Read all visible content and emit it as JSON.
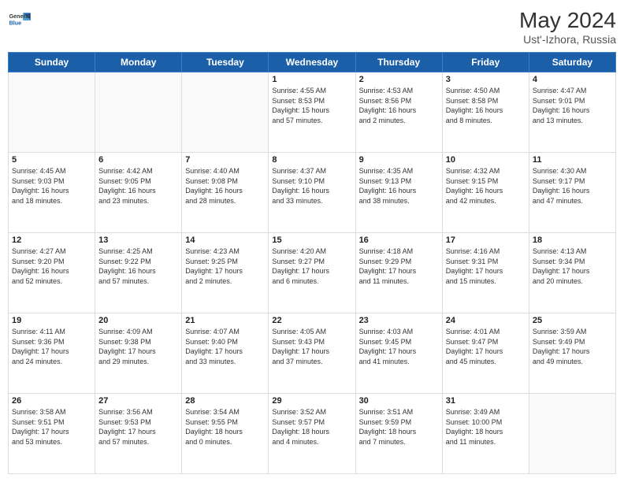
{
  "header": {
    "logo_general": "General",
    "logo_blue": "Blue",
    "month_year": "May 2024",
    "location": "Ust'-Izhora, Russia"
  },
  "weekdays": [
    "Sunday",
    "Monday",
    "Tuesday",
    "Wednesday",
    "Thursday",
    "Friday",
    "Saturday"
  ],
  "weeks": [
    [
      {
        "day": "",
        "info": ""
      },
      {
        "day": "",
        "info": ""
      },
      {
        "day": "",
        "info": ""
      },
      {
        "day": "1",
        "info": "Sunrise: 4:55 AM\nSunset: 8:53 PM\nDaylight: 15 hours\nand 57 minutes."
      },
      {
        "day": "2",
        "info": "Sunrise: 4:53 AM\nSunset: 8:56 PM\nDaylight: 16 hours\nand 2 minutes."
      },
      {
        "day": "3",
        "info": "Sunrise: 4:50 AM\nSunset: 8:58 PM\nDaylight: 16 hours\nand 8 minutes."
      },
      {
        "day": "4",
        "info": "Sunrise: 4:47 AM\nSunset: 9:01 PM\nDaylight: 16 hours\nand 13 minutes."
      }
    ],
    [
      {
        "day": "5",
        "info": "Sunrise: 4:45 AM\nSunset: 9:03 PM\nDaylight: 16 hours\nand 18 minutes."
      },
      {
        "day": "6",
        "info": "Sunrise: 4:42 AM\nSunset: 9:05 PM\nDaylight: 16 hours\nand 23 minutes."
      },
      {
        "day": "7",
        "info": "Sunrise: 4:40 AM\nSunset: 9:08 PM\nDaylight: 16 hours\nand 28 minutes."
      },
      {
        "day": "8",
        "info": "Sunrise: 4:37 AM\nSunset: 9:10 PM\nDaylight: 16 hours\nand 33 minutes."
      },
      {
        "day": "9",
        "info": "Sunrise: 4:35 AM\nSunset: 9:13 PM\nDaylight: 16 hours\nand 38 minutes."
      },
      {
        "day": "10",
        "info": "Sunrise: 4:32 AM\nSunset: 9:15 PM\nDaylight: 16 hours\nand 42 minutes."
      },
      {
        "day": "11",
        "info": "Sunrise: 4:30 AM\nSunset: 9:17 PM\nDaylight: 16 hours\nand 47 minutes."
      }
    ],
    [
      {
        "day": "12",
        "info": "Sunrise: 4:27 AM\nSunset: 9:20 PM\nDaylight: 16 hours\nand 52 minutes."
      },
      {
        "day": "13",
        "info": "Sunrise: 4:25 AM\nSunset: 9:22 PM\nDaylight: 16 hours\nand 57 minutes."
      },
      {
        "day": "14",
        "info": "Sunrise: 4:23 AM\nSunset: 9:25 PM\nDaylight: 17 hours\nand 2 minutes."
      },
      {
        "day": "15",
        "info": "Sunrise: 4:20 AM\nSunset: 9:27 PM\nDaylight: 17 hours\nand 6 minutes."
      },
      {
        "day": "16",
        "info": "Sunrise: 4:18 AM\nSunset: 9:29 PM\nDaylight: 17 hours\nand 11 minutes."
      },
      {
        "day": "17",
        "info": "Sunrise: 4:16 AM\nSunset: 9:31 PM\nDaylight: 17 hours\nand 15 minutes."
      },
      {
        "day": "18",
        "info": "Sunrise: 4:13 AM\nSunset: 9:34 PM\nDaylight: 17 hours\nand 20 minutes."
      }
    ],
    [
      {
        "day": "19",
        "info": "Sunrise: 4:11 AM\nSunset: 9:36 PM\nDaylight: 17 hours\nand 24 minutes."
      },
      {
        "day": "20",
        "info": "Sunrise: 4:09 AM\nSunset: 9:38 PM\nDaylight: 17 hours\nand 29 minutes."
      },
      {
        "day": "21",
        "info": "Sunrise: 4:07 AM\nSunset: 9:40 PM\nDaylight: 17 hours\nand 33 minutes."
      },
      {
        "day": "22",
        "info": "Sunrise: 4:05 AM\nSunset: 9:43 PM\nDaylight: 17 hours\nand 37 minutes."
      },
      {
        "day": "23",
        "info": "Sunrise: 4:03 AM\nSunset: 9:45 PM\nDaylight: 17 hours\nand 41 minutes."
      },
      {
        "day": "24",
        "info": "Sunrise: 4:01 AM\nSunset: 9:47 PM\nDaylight: 17 hours\nand 45 minutes."
      },
      {
        "day": "25",
        "info": "Sunrise: 3:59 AM\nSunset: 9:49 PM\nDaylight: 17 hours\nand 49 minutes."
      }
    ],
    [
      {
        "day": "26",
        "info": "Sunrise: 3:58 AM\nSunset: 9:51 PM\nDaylight: 17 hours\nand 53 minutes."
      },
      {
        "day": "27",
        "info": "Sunrise: 3:56 AM\nSunset: 9:53 PM\nDaylight: 17 hours\nand 57 minutes."
      },
      {
        "day": "28",
        "info": "Sunrise: 3:54 AM\nSunset: 9:55 PM\nDaylight: 18 hours\nand 0 minutes."
      },
      {
        "day": "29",
        "info": "Sunrise: 3:52 AM\nSunset: 9:57 PM\nDaylight: 18 hours\nand 4 minutes."
      },
      {
        "day": "30",
        "info": "Sunrise: 3:51 AM\nSunset: 9:59 PM\nDaylight: 18 hours\nand 7 minutes."
      },
      {
        "day": "31",
        "info": "Sunrise: 3:49 AM\nSunset: 10:00 PM\nDaylight: 18 hours\nand 11 minutes."
      },
      {
        "day": "",
        "info": ""
      }
    ]
  ]
}
